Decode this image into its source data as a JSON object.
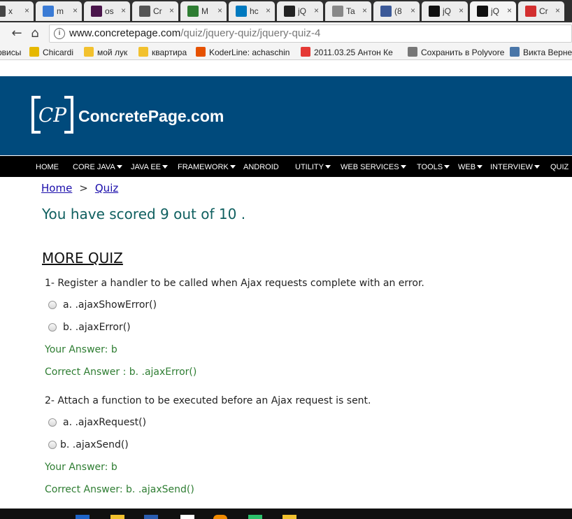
{
  "browser": {
    "tabs": [
      {
        "title": "x",
        "color": "#444"
      },
      {
        "title": "m",
        "color": "#3a7bd5"
      },
      {
        "title": "os",
        "color": "#4a154b"
      },
      {
        "title": "Cr",
        "color": "#555"
      },
      {
        "title": "M",
        "color": "#2e7d32"
      },
      {
        "title": "hc",
        "color": "#0079bf"
      },
      {
        "title": "jQ",
        "color": "#222"
      },
      {
        "title": "Ta",
        "color": "#888"
      },
      {
        "title": "(8",
        "color": "#3b5998"
      },
      {
        "title": "jQ",
        "color": "#111"
      },
      {
        "title": "jQ",
        "color": "#111"
      },
      {
        "title": "Cr",
        "color": "#d32f2f"
      }
    ],
    "url_host": "www.concretepage.com",
    "url_path": "/quiz/jquery-quiz/jquery-quiz-4",
    "nav_back": "←",
    "nav_reload": "⟳",
    "nav_home": "⌂",
    "info_icon": "i",
    "bookmarks": [
      {
        "label": "рвисы",
        "color": "#888"
      },
      {
        "label": "Chicardi",
        "color": "#e6b800"
      },
      {
        "label": "мой лук",
        "color": "#f2c12e"
      },
      {
        "label": "квартира",
        "color": "#f2c12e"
      },
      {
        "label": "KoderLine: achaschin",
        "color": "#e65100"
      },
      {
        "label": "2011.03.25 Антон Ке",
        "color": "#e53935"
      },
      {
        "label": "Сохранить в Polyvore",
        "color": "#777"
      },
      {
        "label": "Викта Верне",
        "color": "#4a76a8"
      }
    ]
  },
  "site": {
    "logo_text": "ConcretePage.com",
    "logo_mark": "CP",
    "nav": [
      {
        "label": "HOME",
        "caret": false
      },
      {
        "label": "CORE JAVA",
        "caret": true
      },
      {
        "label": "JAVA EE",
        "caret": true
      },
      {
        "label": "FRAMEWORK",
        "caret": true
      },
      {
        "label": "ANDROID",
        "caret": false
      },
      {
        "label": "UTILITY",
        "caret": true
      },
      {
        "label": "WEB SERVICES",
        "caret": true
      },
      {
        "label": "TOOLS",
        "caret": true
      },
      {
        "label": "WEB",
        "caret": true
      },
      {
        "label": "INTERVIEW",
        "caret": true
      },
      {
        "label": "QUIZ",
        "caret": false
      }
    ]
  },
  "breadcrumb": {
    "home": "Home",
    "sep": ">",
    "quiz": "Quiz"
  },
  "score_text": "You have scored 9 out of 10 .",
  "more_quiz": "MORE QUIZ",
  "questions": [
    {
      "text": "1- Register a handler to be called when Ajax requests complete with an error.",
      "options": [
        "a. .ajaxShowError()",
        "b. .ajaxError()"
      ],
      "your_answer": "Your Answer: b",
      "correct_answer": "Correct Answer : b. .ajaxError()"
    },
    {
      "text": "2- Attach a function to be executed before an Ajax request is sent.",
      "options": [
        "a. .ajaxRequest()",
        "b. .ajaxSend()"
      ],
      "your_answer": "Your Answer: b",
      "correct_answer": "Correct Answer: b. .ajaxSend()"
    }
  ]
}
